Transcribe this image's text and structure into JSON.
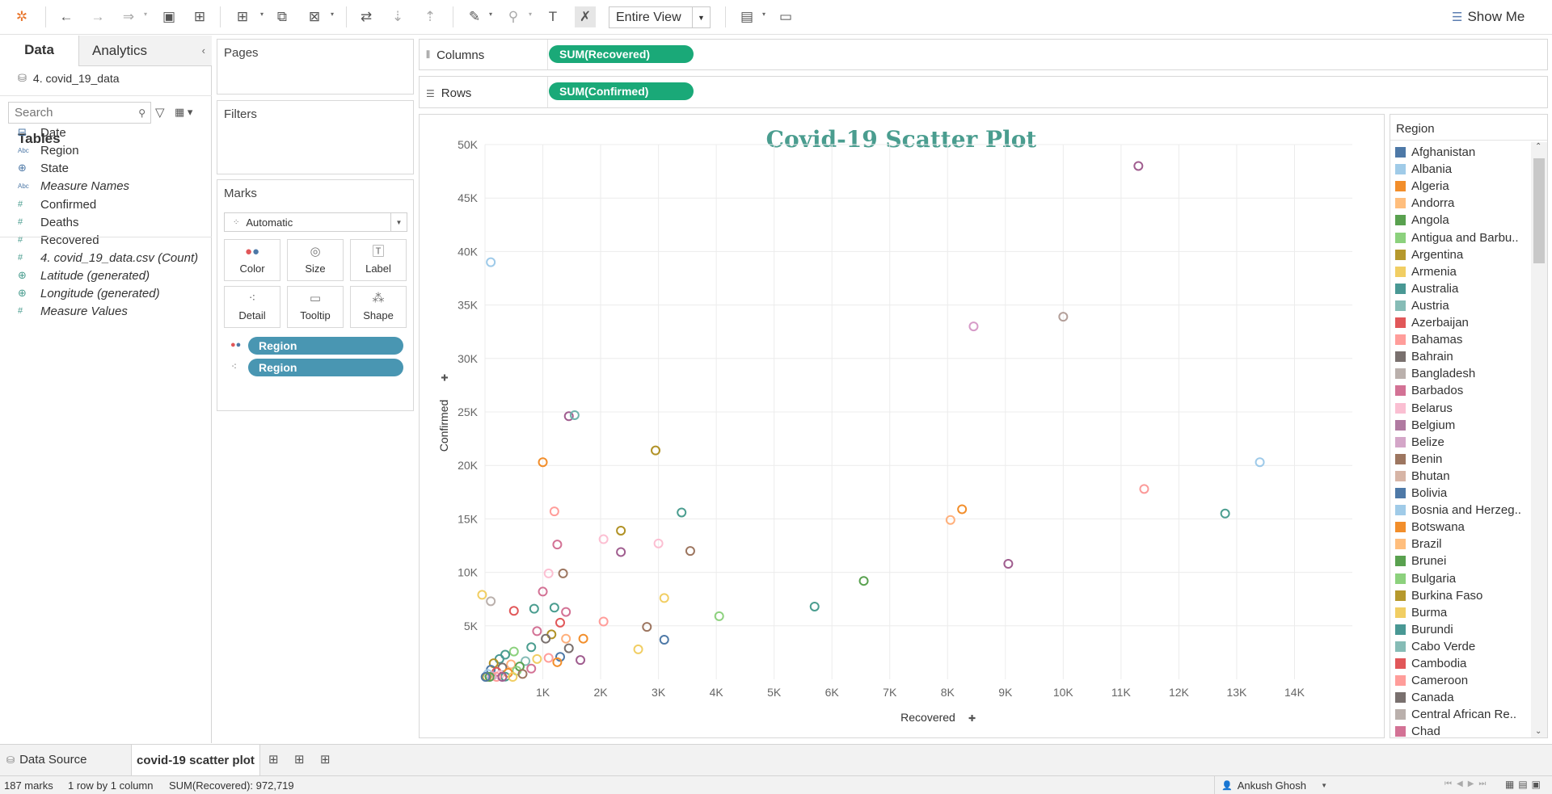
{
  "toolbar": {
    "view_select": "Entire View",
    "show_me_label": "Show Me"
  },
  "data_pane": {
    "tabs": [
      "Data",
      "Analytics"
    ],
    "datasource": "4. covid_19_data",
    "search_placeholder": "Search",
    "tables_heading": "Tables",
    "fields": [
      {
        "icon": "calendar-icon",
        "glyph": "⊟",
        "label": "Date",
        "italic": false
      },
      {
        "icon": "abc-icon",
        "glyph": "Abc",
        "label": "Region",
        "italic": false
      },
      {
        "icon": "globe-icon",
        "glyph": "⊕",
        "label": "State",
        "italic": false
      },
      {
        "icon": "abc-icon",
        "glyph": "Abc",
        "label": "Measure Names",
        "italic": true
      },
      {
        "icon": "hash-icon",
        "glyph": "#",
        "label": "Confirmed",
        "italic": false
      },
      {
        "icon": "hash-icon",
        "glyph": "#",
        "label": "Deaths",
        "italic": false
      },
      {
        "icon": "hash-icon",
        "glyph": "#",
        "label": "Recovered",
        "italic": false
      },
      {
        "icon": "hash-icon",
        "glyph": "#",
        "label": "4. covid_19_data.csv (Count)",
        "italic": true
      },
      {
        "icon": "globe-icon",
        "glyph": "⊕",
        "label": "Latitude (generated)",
        "italic": true
      },
      {
        "icon": "globe-icon",
        "glyph": "⊕",
        "label": "Longitude (generated)",
        "italic": true
      },
      {
        "icon": "hash-icon",
        "glyph": "#",
        "label": "Measure Values",
        "italic": true
      }
    ]
  },
  "pages_card": {
    "title": "Pages"
  },
  "filters_card": {
    "title": "Filters"
  },
  "marks_card": {
    "title": "Marks",
    "mark_type": "Automatic",
    "buttons": [
      "Color",
      "Size",
      "Label",
      "Detail",
      "Tooltip",
      "Shape"
    ],
    "pills": [
      "Region",
      "Region"
    ]
  },
  "shelves": {
    "columns_label": "Columns",
    "columns_pill": "SUM(Recovered)",
    "rows_label": "Rows",
    "rows_pill": "SUM(Confirmed)"
  },
  "chart_data": {
    "type": "scatter",
    "title": "Covid-19 Scatter Plot",
    "xlabel": "Recovered",
    "ylabel": "Confirmed",
    "xlim": [
      0,
      15000
    ],
    "ylim": [
      0,
      50000
    ],
    "x_ticks": [
      "1K",
      "2K",
      "3K",
      "4K",
      "5K",
      "6K",
      "7K",
      "8K",
      "9K",
      "10K",
      "11K",
      "12K",
      "13K",
      "14K"
    ],
    "y_ticks": [
      "5K",
      "10K",
      "15K",
      "20K",
      "25K",
      "30K",
      "35K",
      "40K",
      "45K",
      "50K"
    ],
    "grid": true,
    "marker": "hollow-circle",
    "points": [
      {
        "x": 11300,
        "y": 48000,
        "color": "#a05d8f"
      },
      {
        "x": 100,
        "y": 39000,
        "color": "#9ecae9"
      },
      {
        "x": 10000,
        "y": 33900,
        "color": "#b4a09a"
      },
      {
        "x": 8450,
        "y": 33000,
        "color": "#d79bc8"
      },
      {
        "x": 1450,
        "y": 24600,
        "color": "#a05d8f"
      },
      {
        "x": 1550,
        "y": 24700,
        "color": "#6fb3ac"
      },
      {
        "x": 1000,
        "y": 20300,
        "color": "#f28e2b"
      },
      {
        "x": 2950,
        "y": 21400,
        "color": "#b19226"
      },
      {
        "x": 13400,
        "y": 20300,
        "color": "#9ecae9"
      },
      {
        "x": 11400,
        "y": 17800,
        "color": "#fb9a99"
      },
      {
        "x": 12800,
        "y": 15500,
        "color": "#4a9d8f"
      },
      {
        "x": 3400,
        "y": 15600,
        "color": "#4a9d8f"
      },
      {
        "x": 1200,
        "y": 15700,
        "color": "#ff9d9a"
      },
      {
        "x": 8250,
        "y": 15900,
        "color": "#f28e2b"
      },
      {
        "x": 8050,
        "y": 14900,
        "color": "#ffb07c"
      },
      {
        "x": 2350,
        "y": 13900,
        "color": "#b19226"
      },
      {
        "x": 2050,
        "y": 13100,
        "color": "#fcbfd2"
      },
      {
        "x": 1250,
        "y": 12600,
        "color": "#d37295"
      },
      {
        "x": 3000,
        "y": 12700,
        "color": "#fcbfd2"
      },
      {
        "x": 2350,
        "y": 11900,
        "color": "#a05d8f"
      },
      {
        "x": 3550,
        "y": 12000,
        "color": "#9d7660"
      },
      {
        "x": 9050,
        "y": 10800,
        "color": "#a05d8f"
      },
      {
        "x": 1350,
        "y": 9900,
        "color": "#9d7660"
      },
      {
        "x": 1100,
        "y": 9900,
        "color": "#fcbfd2"
      },
      {
        "x": 6550,
        "y": 9200,
        "color": "#59a14f"
      },
      {
        "x": 1000,
        "y": 8200,
        "color": "#d37295"
      },
      {
        "x": -50,
        "y": 7900,
        "color": "#f1ce63"
      },
      {
        "x": 100,
        "y": 7300,
        "color": "#bab0ac"
      },
      {
        "x": 3100,
        "y": 7600,
        "color": "#f1ce63"
      },
      {
        "x": 5700,
        "y": 6800,
        "color": "#4a9d8f"
      },
      {
        "x": 500,
        "y": 6400,
        "color": "#e15759"
      },
      {
        "x": 850,
        "y": 6600,
        "color": "#4a9d8f"
      },
      {
        "x": 1200,
        "y": 6700,
        "color": "#4a9d8f"
      },
      {
        "x": 1400,
        "y": 6300,
        "color": "#d37295"
      },
      {
        "x": 4050,
        "y": 5900,
        "color": "#8cd17d"
      },
      {
        "x": 2050,
        "y": 5400,
        "color": "#ff9d9a"
      },
      {
        "x": 1300,
        "y": 5300,
        "color": "#e15759"
      },
      {
        "x": 2800,
        "y": 4900,
        "color": "#9d7660"
      },
      {
        "x": 900,
        "y": 4500,
        "color": "#d37295"
      },
      {
        "x": 1150,
        "y": 4200,
        "color": "#b19226"
      },
      {
        "x": 1050,
        "y": 3800,
        "color": "#79706e"
      },
      {
        "x": 1400,
        "y": 3800,
        "color": "#ffb07c"
      },
      {
        "x": 1700,
        "y": 3800,
        "color": "#f28e2b"
      },
      {
        "x": 3100,
        "y": 3700,
        "color": "#4e79a7"
      },
      {
        "x": 1450,
        "y": 2900,
        "color": "#79706e"
      },
      {
        "x": 2650,
        "y": 2800,
        "color": "#f1ce63"
      },
      {
        "x": 800,
        "y": 3000,
        "color": "#4a9d8f"
      },
      {
        "x": 500,
        "y": 2600,
        "color": "#8cd17d"
      },
      {
        "x": 1300,
        "y": 2100,
        "color": "#4e79a7"
      },
      {
        "x": 1650,
        "y": 1800,
        "color": "#a05d8f"
      },
      {
        "x": 1100,
        "y": 2000,
        "color": "#ff9d9a"
      },
      {
        "x": 900,
        "y": 1900,
        "color": "#f1ce63"
      },
      {
        "x": 350,
        "y": 2300,
        "color": "#4a9d8f"
      },
      {
        "x": 700,
        "y": 1700,
        "color": "#86bcb6"
      },
      {
        "x": 1250,
        "y": 1600,
        "color": "#f28e2b"
      },
      {
        "x": 250,
        "y": 1900,
        "color": "#499894"
      },
      {
        "x": 450,
        "y": 1400,
        "color": "#ffb07c"
      },
      {
        "x": 150,
        "y": 1500,
        "color": "#b19226"
      },
      {
        "x": 600,
        "y": 1200,
        "color": "#59a14f"
      },
      {
        "x": 800,
        "y": 1000,
        "color": "#d37295"
      },
      {
        "x": 300,
        "y": 1100,
        "color": "#79706e"
      },
      {
        "x": 100,
        "y": 900,
        "color": "#4e79a7"
      },
      {
        "x": 550,
        "y": 800,
        "color": "#8cd17d"
      },
      {
        "x": 200,
        "y": 700,
        "color": "#e15759"
      },
      {
        "x": 400,
        "y": 600,
        "color": "#f28e2b"
      },
      {
        "x": 50,
        "y": 500,
        "color": "#a0cbe8"
      },
      {
        "x": 650,
        "y": 500,
        "color": "#9d7660"
      },
      {
        "x": 250,
        "y": 400,
        "color": "#fcbfd2"
      },
      {
        "x": 120,
        "y": 300,
        "color": "#d4a6c8"
      },
      {
        "x": 350,
        "y": 250,
        "color": "#4a9d8f"
      },
      {
        "x": 30,
        "y": 200,
        "color": "#b6992d"
      },
      {
        "x": 480,
        "y": 150,
        "color": "#f1ce63"
      },
      {
        "x": 200,
        "y": 100,
        "color": "#ff9d9a"
      },
      {
        "x": 80,
        "y": 80,
        "color": "#59a14f"
      },
      {
        "x": 300,
        "y": 50,
        "color": "#a05d8f"
      },
      {
        "x": 10,
        "y": 30,
        "color": "#4e79a7"
      }
    ]
  },
  "legend": {
    "title": "Region",
    "items": [
      {
        "label": "Afghanistan",
        "color": "#4e79a7"
      },
      {
        "label": "Albania",
        "color": "#a0cbe8"
      },
      {
        "label": "Algeria",
        "color": "#f28e2b"
      },
      {
        "label": "Andorra",
        "color": "#ffbe7d"
      },
      {
        "label": "Angola",
        "color": "#59a14f"
      },
      {
        "label": "Antigua and Barbu..",
        "color": "#8cd17d"
      },
      {
        "label": "Argentina",
        "color": "#b6992d"
      },
      {
        "label": "Armenia",
        "color": "#f1ce63"
      },
      {
        "label": "Australia",
        "color": "#499894"
      },
      {
        "label": "Austria",
        "color": "#86bcb6"
      },
      {
        "label": "Azerbaijan",
        "color": "#e15759"
      },
      {
        "label": "Bahamas",
        "color": "#ff9d9a"
      },
      {
        "label": "Bahrain",
        "color": "#79706e"
      },
      {
        "label": "Bangladesh",
        "color": "#bab0ac"
      },
      {
        "label": "Barbados",
        "color": "#d37295"
      },
      {
        "label": "Belarus",
        "color": "#fabfd2"
      },
      {
        "label": "Belgium",
        "color": "#b07aa1"
      },
      {
        "label": "Belize",
        "color": "#d4a6c8"
      },
      {
        "label": "Benin",
        "color": "#9d7660"
      },
      {
        "label": "Bhutan",
        "color": "#d7b5a6"
      },
      {
        "label": "Bolivia",
        "color": "#4e79a7"
      },
      {
        "label": "Bosnia and Herzeg..",
        "color": "#a0cbe8"
      },
      {
        "label": "Botswana",
        "color": "#f28e2b"
      },
      {
        "label": "Brazil",
        "color": "#ffbe7d"
      },
      {
        "label": "Brunei",
        "color": "#59a14f"
      },
      {
        "label": "Bulgaria",
        "color": "#8cd17d"
      },
      {
        "label": "Burkina Faso",
        "color": "#b6992d"
      },
      {
        "label": "Burma",
        "color": "#f1ce63"
      },
      {
        "label": "Burundi",
        "color": "#499894"
      },
      {
        "label": "Cabo Verde",
        "color": "#86bcb6"
      },
      {
        "label": "Cambodia",
        "color": "#e15759"
      },
      {
        "label": "Cameroon",
        "color": "#ff9d9a"
      },
      {
        "label": "Canada",
        "color": "#79706e"
      },
      {
        "label": "Central African Re..",
        "color": "#bab0ac"
      },
      {
        "label": "Chad",
        "color": "#d37295"
      }
    ]
  },
  "sheet_tabs": {
    "data_source": "Data Source",
    "active_sheet": "covid-19 scatter plot"
  },
  "status_bar": {
    "marks": "187 marks",
    "rows_cols": "1 row by 1 column",
    "sum": "SUM(Recovered): 972,719",
    "user": "Ankush Ghosh"
  }
}
